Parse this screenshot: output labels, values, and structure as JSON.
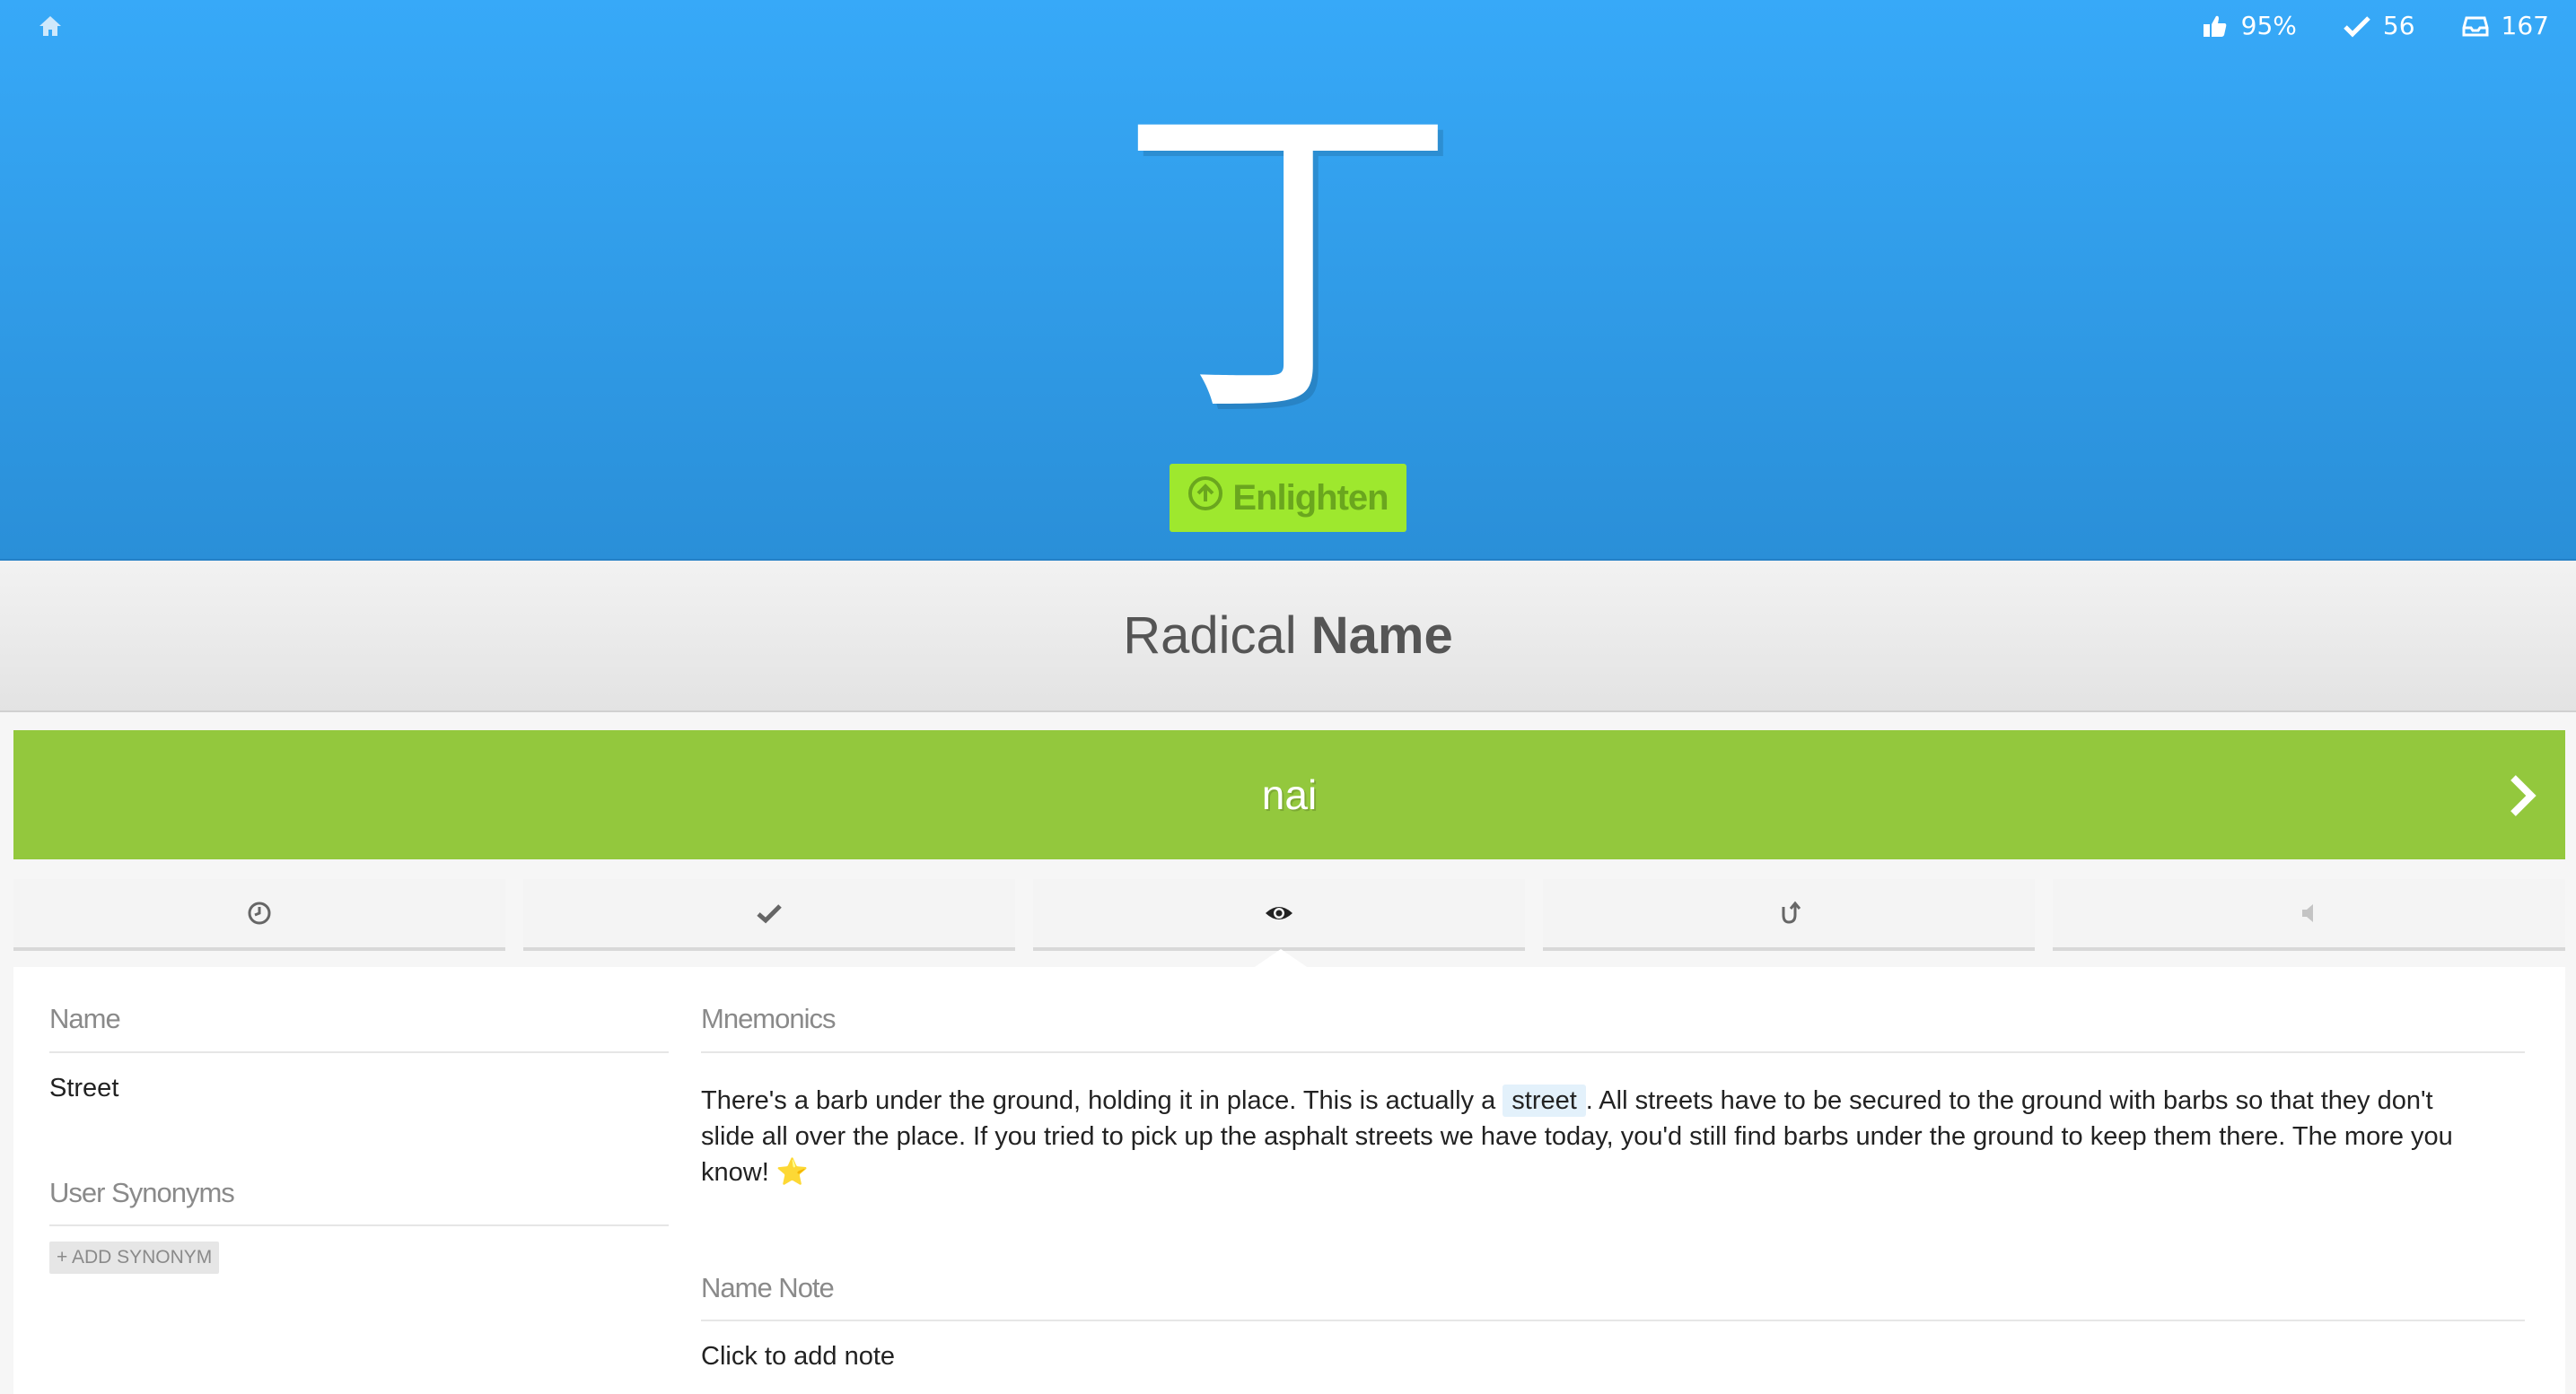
{
  "header": {
    "stats": {
      "approval": "95%",
      "correct": "56",
      "inbox": "167"
    },
    "character": "丁",
    "enlighten_label": "Enlighten"
  },
  "section_band": {
    "title_prefix": "Radical",
    "title_bold": "Name"
  },
  "answer": {
    "text": "nai"
  },
  "tabs": [
    {
      "icon": "clock-icon"
    },
    {
      "icon": "check-icon"
    },
    {
      "icon": "eye-icon"
    },
    {
      "icon": "undo-icon"
    },
    {
      "icon": "audio-icon"
    }
  ],
  "details": {
    "name_heading": "Name",
    "name_value": "Street",
    "synonyms_heading": "User Synonyms",
    "add_synonym_label": "+ ADD SYNONYM",
    "mnemonics_heading": "Mnemonics",
    "mnemonic_part1": "There's a barb under the ground, holding it in place. This is actually a",
    "mnemonic_highlight": "street",
    "mnemonic_part2": ". All streets have to be secured to the ground with barbs so that they don't",
    "mnemonic_line2": "slide all over the place. If you tried to pick up the asphalt streets we have today, you'd still find barbs under the ground to keep them there. The more you",
    "mnemonic_line3": "know!",
    "mnemonic_emoji": "⭐",
    "name_note_heading": "Name Note",
    "name_note_placeholder": "Click to add note"
  },
  "colors": {
    "header_top": "#37a9f8",
    "header_bottom": "#2a8fd8",
    "answer_green": "#93c83d",
    "enlighten_bg": "#9ee82e",
    "enlighten_text": "#6aa61e"
  }
}
